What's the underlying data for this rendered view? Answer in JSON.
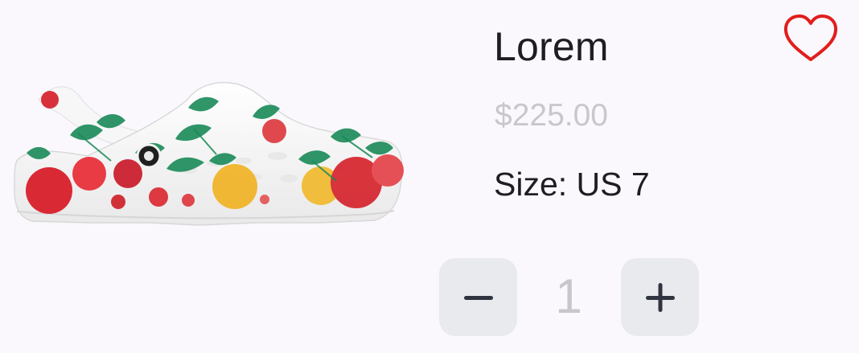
{
  "product": {
    "name": "Lorem",
    "price": "$225.00",
    "size": "Size: US 7",
    "quantity": "1"
  },
  "icons": {
    "favorite": "heart-icon",
    "decrease": "minus-icon",
    "increase": "plus-icon"
  },
  "colors": {
    "background": "#fbf8fd",
    "heart": "#e21d1d",
    "button_bg": "#e8eaee",
    "button_icon": "#2f3440",
    "muted_text": "#c9c7cc",
    "primary_text": "#1f1d24"
  }
}
